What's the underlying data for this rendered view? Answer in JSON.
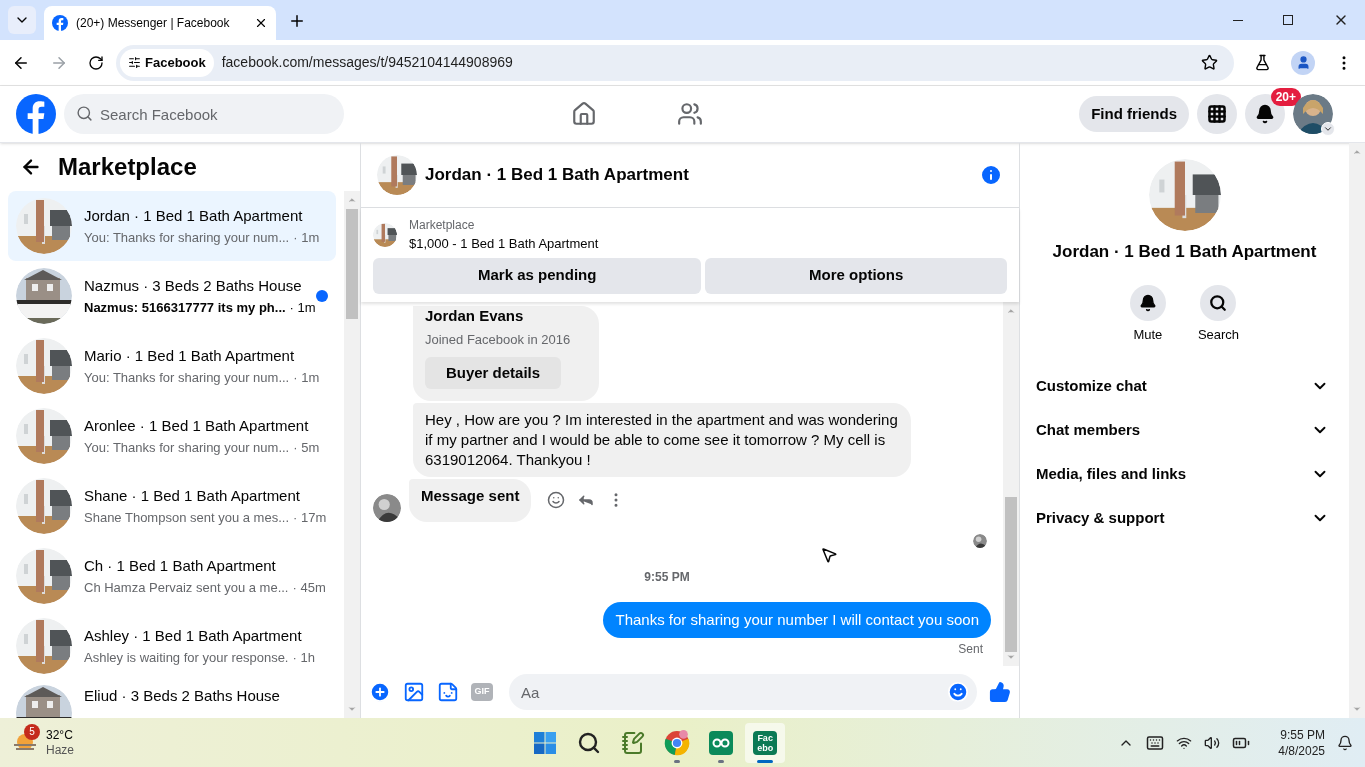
{
  "browser": {
    "tab_title": "(20+) Messenger | Facebook",
    "site_chip": "Facebook",
    "url": "facebook.com/messages/t/9452104144908969"
  },
  "header": {
    "search_placeholder": "Search Facebook",
    "find_friends": "Find friends",
    "notification_badge": "20+"
  },
  "sidebar": {
    "title": "Marketplace",
    "conversations": [
      {
        "title": "Jordan · 1 Bed 1 Bath Apartment",
        "preview": "You: Thanks for sharing your num...",
        "time": "· 1m",
        "unread": false,
        "selected": true
      },
      {
        "title": "Nazmus · 3 Beds 2 Baths House",
        "preview": "Nazmus: 5166317777 its my ph...",
        "time": "· 1m",
        "unread": true,
        "selected": false
      },
      {
        "title": "Mario · 1 Bed 1 Bath Apartment",
        "preview": "You: Thanks for sharing your num...",
        "time": "· 1m",
        "unread": false,
        "selected": false
      },
      {
        "title": "Aronlee · 1 Bed 1 Bath Apartment",
        "preview": "You: Thanks for sharing your num...",
        "time": "· 5m",
        "unread": false,
        "selected": false
      },
      {
        "title": "Shane · 1 Bed 1 Bath Apartment",
        "preview": "Shane Thompson sent you a mes...",
        "time": "· 17m",
        "unread": false,
        "selected": false
      },
      {
        "title": "Ch · 1 Bed 1 Bath Apartment",
        "preview": "Ch Hamza Pervaiz sent you a me...",
        "time": "· 45m",
        "unread": false,
        "selected": false
      },
      {
        "title": "Ashley · 1 Bed 1 Bath Apartment",
        "preview": "Ashley is waiting for your response.",
        "time": "· 1h",
        "unread": false,
        "selected": false
      },
      {
        "title": "Eliud · 3 Beds 2 Baths House",
        "unread": false,
        "selected": false
      }
    ]
  },
  "chat": {
    "title": "Jordan · 1 Bed 1 Bath Apartment",
    "listing": {
      "label": "Marketplace",
      "title": "$1,000 - 1 Bed 1 Bath Apartment"
    },
    "actions": [
      "Mark as pending",
      "More options"
    ],
    "messages": [
      {
        "kind": "buyer_card",
        "name": "Jordan Evans",
        "detail": "Joined Facebook in 2016",
        "button": "Buyer details"
      },
      {
        "kind": "incoming",
        "text": "Hey , How are you ? Im interested in the apartment and was wondering if my partner and I would be able to come see it tomorrow ? My cell is 6319012064. Thankyou !"
      },
      {
        "kind": "incoming_last",
        "text": "Message sent"
      },
      {
        "kind": "seen"
      },
      {
        "kind": "timestamp",
        "text": "9:55 PM"
      },
      {
        "kind": "outgoing",
        "text": "Thanks for sharing your number I will contact you soon"
      },
      {
        "kind": "status",
        "text": "Sent"
      }
    ],
    "composer": {
      "gif_label": "GIF",
      "placeholder": "Aa"
    }
  },
  "info_panel": {
    "title": "Jordan · 1 Bed 1 Bath Apartment",
    "actions": [
      {
        "kind": "mute",
        "label": "Mute"
      },
      {
        "kind": "search",
        "label": "Search"
      }
    ],
    "sections": [
      {
        "label": "Customize chat",
        "expanded": false
      },
      {
        "label": "Chat members",
        "expanded": false
      },
      {
        "label": "Media, files and links",
        "expanded": false
      },
      {
        "label": "Privacy & support",
        "expanded": false
      }
    ]
  },
  "taskbar": {
    "weather": {
      "badge": "5",
      "temperature": "32°C",
      "condition": "Haze"
    },
    "apps": [
      {
        "kind": "start",
        "running": false,
        "selected": false
      },
      {
        "kind": "search",
        "running": false,
        "selected": false
      },
      {
        "kind": "editor",
        "running": false,
        "selected": false
      },
      {
        "kind": "chrome",
        "running": true,
        "selected": false
      },
      {
        "kind": "qq",
        "running": true,
        "selected": false
      },
      {
        "kind": "facebook",
        "label": "Fac ebo",
        "running": true,
        "selected": true
      }
    ],
    "clock": {
      "time": "9:55 PM",
      "date": "4/8/2025"
    }
  }
}
